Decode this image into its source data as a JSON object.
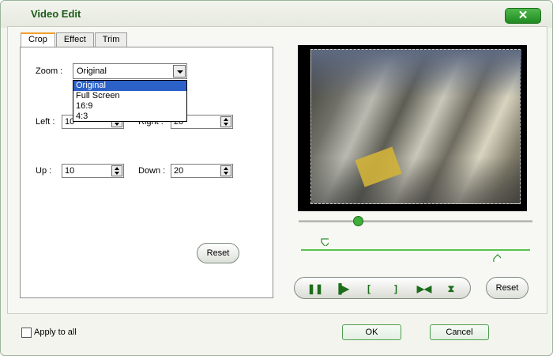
{
  "window": {
    "title": "Video Edit",
    "close_symbol": "✕"
  },
  "tabs": [
    {
      "label": "Crop",
      "active": true
    },
    {
      "label": "Effect",
      "active": false
    },
    {
      "label": "Trim",
      "active": false
    }
  ],
  "crop": {
    "zoom_label": "Zoom :",
    "zoom_value": "Original",
    "zoom_options": [
      "Original",
      "Full Screen",
      "16:9",
      "4:3"
    ],
    "left_label": "Left :",
    "left_value": "10",
    "right_label": "Right :",
    "right_value": "20",
    "up_label": "Up :",
    "up_value": "10",
    "down_label": "Down :",
    "down_value": "20",
    "reset_label": "Reset"
  },
  "player": {
    "reset_label": "Reset",
    "controls": [
      "pause-icon",
      "step-frame-icon",
      "mark-in-icon",
      "mark-out-icon",
      "jump-icon",
      "split-icon"
    ]
  },
  "footer": {
    "apply_all_label": "Apply to all",
    "ok_label": "OK",
    "cancel_label": "Cancel"
  },
  "colors": {
    "accent": "#1c5a18",
    "selection": "#2c61c8",
    "slider": "#3fae3b"
  }
}
